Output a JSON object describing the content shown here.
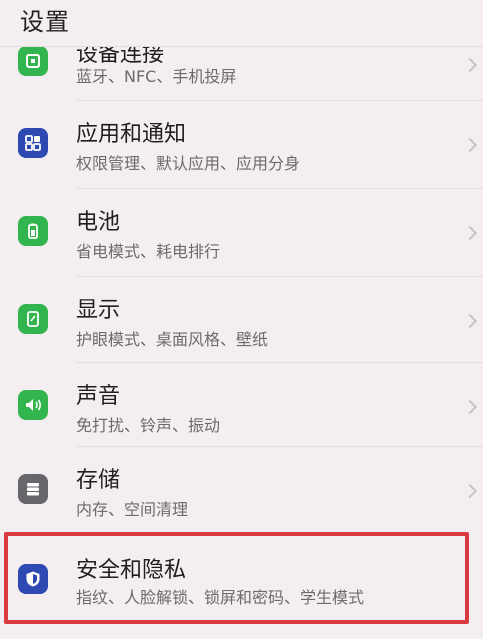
{
  "header": {
    "title": "设置"
  },
  "items": [
    {
      "title": "设备连接",
      "subtitle": "蓝牙、NFC、手机投屏",
      "icon": "device-connection-icon",
      "color": "#32b54f"
    },
    {
      "title": "应用和通知",
      "subtitle": "权限管理、默认应用、应用分身",
      "icon": "apps-icon",
      "color": "#2f49b3"
    },
    {
      "title": "电池",
      "subtitle": "省电模式、耗电排行",
      "icon": "battery-icon",
      "color": "#32b54f"
    },
    {
      "title": "显示",
      "subtitle": "护眼模式、桌面风格、壁纸",
      "icon": "display-icon",
      "color": "#32b54f"
    },
    {
      "title": "声音",
      "subtitle": "免打扰、铃声、振动",
      "icon": "sound-icon",
      "color": "#32b54f"
    },
    {
      "title": "存储",
      "subtitle": "内存、空间清理",
      "icon": "storage-icon",
      "color": "#66666b"
    },
    {
      "title": "安全和隐私",
      "subtitle": "指纹、人脸解锁、锁屏和密码、学生模式",
      "icon": "shield-icon",
      "color": "#2f49b3"
    }
  ],
  "highlight_color": "#d93a40"
}
